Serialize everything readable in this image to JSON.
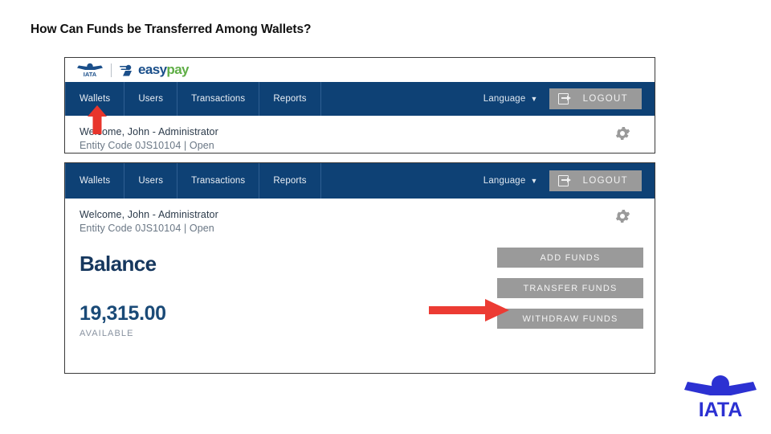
{
  "slide": {
    "title": "How Can Funds be Transferred Among Wallets?"
  },
  "brand": {
    "iata_label": "IATA",
    "product_easy": "easy",
    "product_pay": "pay"
  },
  "nav": {
    "items": [
      {
        "label": "Wallets"
      },
      {
        "label": "Users"
      },
      {
        "label": "Transactions"
      },
      {
        "label": "Reports"
      }
    ],
    "language_label": "Language",
    "language_caret": "▼",
    "logout_label": "LOGOUT"
  },
  "account": {
    "welcome": "Welcome, John - Administrator",
    "entity": "Entity Code 0JS10104 | Open"
  },
  "balance": {
    "label": "Balance",
    "amount": "19,315.00",
    "sub": "AVAILABLE"
  },
  "actions": [
    {
      "label": "ADD FUNDS"
    },
    {
      "label": "TRANSFER FUNDS"
    },
    {
      "label": "WITHDRAW FUNDS"
    }
  ],
  "annotations": {
    "arrow_up_target": "Wallets",
    "arrow_right_target": "TRANSFER FUNDS"
  },
  "footer": {
    "logo_text": "IATA"
  },
  "colors": {
    "nav_blue": "#0e4175",
    "brand_blue": "#1b4f8a",
    "brand_green": "#5fae46",
    "button_gray": "#9a9a9a",
    "annotation_red": "#e8352c",
    "balance_blue": "#16375e",
    "logo_blue": "#2c31d2"
  }
}
